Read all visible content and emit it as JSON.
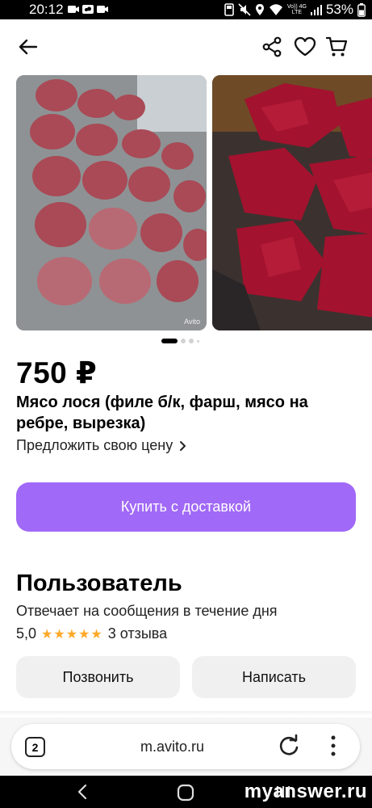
{
  "status_bar": {
    "time": "20:12",
    "battery": "53%",
    "network_top": "Vo)) 4G",
    "network_bottom": "LTE"
  },
  "header": {
    "icons": [
      "back-arrow-icon",
      "share-icon",
      "heart-icon",
      "cart-icon"
    ]
  },
  "gallery": {
    "watermark": "Avito",
    "dot_count": 4,
    "active_dot": 0
  },
  "listing": {
    "price": "750 ₽",
    "title": "Мясо лося (филе б/к, фарш, мясо на ребре, вырезка)",
    "offer_price_label": "Предложить свою цену",
    "buy_button": "Купить с доставкой"
  },
  "seller": {
    "name": "Пользователь",
    "reply_time": "Отвечает на сообщения в течение дня",
    "rating": "5,0",
    "stars": "★★★★★",
    "reviews": "3 отзыва",
    "call_button": "Позвонить",
    "write_button": "Написать"
  },
  "browser": {
    "tabs_count": "2",
    "url": "m.avito.ru"
  },
  "watermark_site": "myanswer.ru",
  "colors": {
    "accent": "#a169f7",
    "stars": "#ffa928"
  }
}
